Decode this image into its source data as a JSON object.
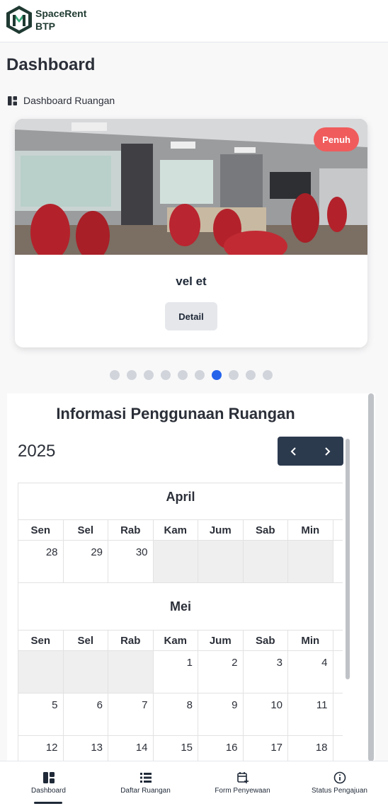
{
  "app": {
    "brand_line1": "SpaceRent",
    "brand_line2": "BTP"
  },
  "page": {
    "title": "Dashboard",
    "section": "Dashboard Ruangan"
  },
  "room_card": {
    "name": "vel et",
    "status_badge": "Penuh",
    "detail_label": "Detail",
    "badge_color": "#f05c5c"
  },
  "carousel": {
    "total": 10,
    "active_index": 6
  },
  "calendar": {
    "title": "Informasi Penggunaan Ruangan",
    "year": "2025",
    "weekdays": [
      "Sen",
      "Sel",
      "Rab",
      "Kam",
      "Jum",
      "Sab",
      "Min"
    ],
    "months": [
      {
        "name": "April",
        "weeks": [
          [
            "28",
            "29",
            "30",
            "",
            "",
            "",
            ""
          ]
        ]
      },
      {
        "name": "Mei",
        "weeks": [
          [
            "",
            "",
            "",
            "1",
            "2",
            "3",
            "4"
          ],
          [
            "5",
            "6",
            "7",
            "8",
            "9",
            "10",
            "11"
          ],
          [
            "12",
            "13",
            "14",
            "15",
            "16",
            "17",
            "18"
          ]
        ]
      }
    ]
  },
  "bottom_nav": [
    {
      "label": "Dashboard",
      "icon": "dashboard-icon",
      "active": true
    },
    {
      "label": "Daftar Ruangan",
      "icon": "list-icon"
    },
    {
      "label": "Form Penyewaan",
      "icon": "calendar-plus-icon"
    },
    {
      "label": "Status Pengajuan",
      "icon": "info-icon"
    }
  ],
  "colors": {
    "accent": "#2563eb",
    "nav_dark": "#2c3a4e",
    "brand": "#1f3a32"
  }
}
